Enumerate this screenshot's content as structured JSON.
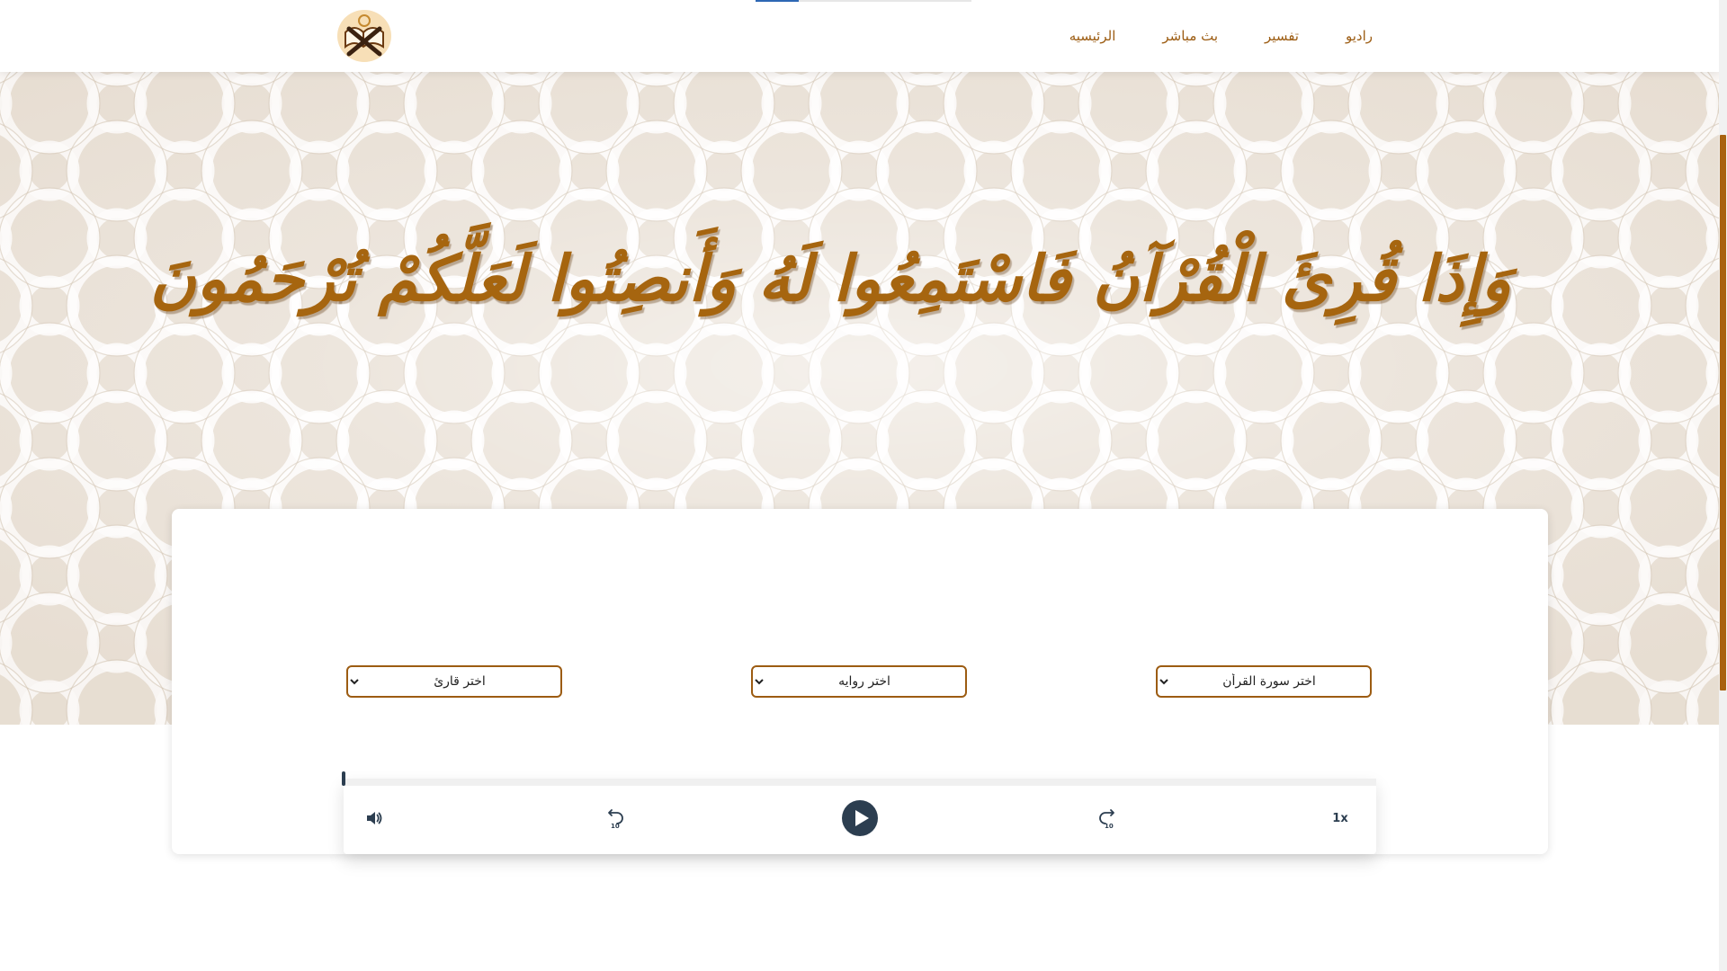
{
  "nav": {
    "items": [
      {
        "label": "راديو"
      },
      {
        "label": "تفسير"
      },
      {
        "label": "بث مباشر"
      },
      {
        "label": "الرئيسيه"
      }
    ],
    "logo_icon": "quran-book-logo"
  },
  "top_progress": {
    "fraction": 0.2
  },
  "hero": {
    "verse": "وَإِذَا قُرِئَ الْقُرْآنُ فَاسْتَمِعُوا لَهُ وَأَنصِتُوا لَعَلَّكُمْ تُرْحَمُونَ"
  },
  "selectors": {
    "surah": "اختر سورة القرأن",
    "riwaya": "اختر روايه",
    "reader": "اختر قارئ"
  },
  "player": {
    "speed": "1x",
    "progress": 0,
    "icons": {
      "volume": "volume-icon",
      "rewind": "rewind-10-icon",
      "play": "play-icon",
      "forward": "forward-10-icon"
    }
  },
  "colors": {
    "accent": "#9c5c12",
    "verse": "#a6650f",
    "player_dark": "#2c3e50",
    "scrollbar_thumb": "#a8620f"
  }
}
